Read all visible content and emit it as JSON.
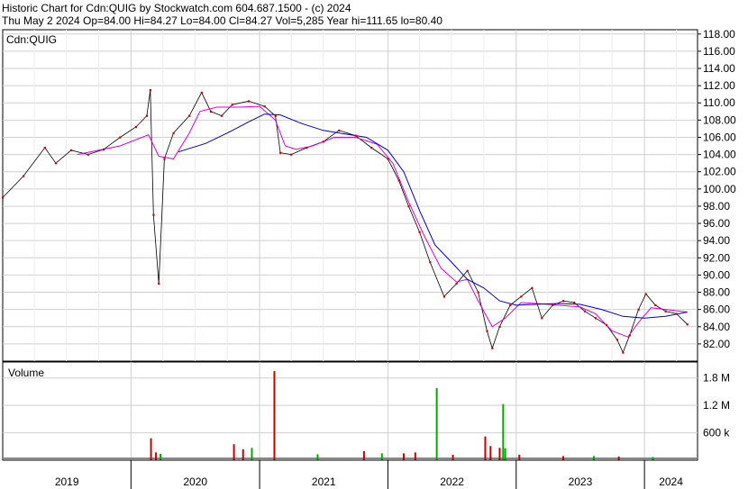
{
  "header": {
    "line1": "Historic Chart for Cdn:QUIG by Stockwatch.com 604.687.1500 - (c) 2024",
    "line2": "Thu May  2 2024  Op=84.00  Hi=84.27  Lo=84.00  Cl=84.27  Vol=5,285  Year hi=111.65  lo=80.40"
  },
  "chart_data": [
    {
      "type": "line",
      "panel_label": "Cdn:QUIG",
      "y_ticks": [
        82,
        84,
        86,
        88,
        90,
        92,
        94,
        96,
        98,
        100,
        102,
        104,
        106,
        108,
        110,
        112,
        114,
        116,
        118
      ],
      "ylim": [
        80.0,
        118.5
      ],
      "x_ticks": [
        "2019",
        "2020",
        "2021",
        "2022",
        "2023",
        "2024"
      ],
      "xlim": [
        "2019-01-01",
        "2024-05-31"
      ],
      "grid": true,
      "colors": {
        "price": "#cc0000",
        "price_alt": "#000000",
        "ma_short": "#dd00dd",
        "ma_long": "#0000cc"
      },
      "series": [
        {
          "values": [
            [
              "2019-01-01",
              99.0
            ],
            [
              "2019-03-01",
              101.5
            ],
            [
              "2019-05-01",
              104.8
            ],
            [
              "2019-06-01",
              103.0
            ],
            [
              "2019-07-15",
              104.5
            ],
            [
              "2019-09-01",
              104.0
            ],
            [
              "2019-10-15",
              104.6
            ],
            [
              "2019-12-01",
              106.0
            ],
            [
              "2020-01-15",
              107.2
            ],
            [
              "2020-02-15",
              108.5
            ],
            [
              "2020-02-25",
              111.5
            ],
            [
              "2020-03-05",
              97.0
            ],
            [
              "2020-03-20",
              89.0
            ],
            [
              "2020-04-05",
              103.5
            ],
            [
              "2020-05-01",
              106.5
            ],
            [
              "2020-06-15",
              108.5
            ],
            [
              "2020-07-20",
              111.2
            ],
            [
              "2020-08-15",
              109.0
            ],
            [
              "2020-09-15",
              108.5
            ],
            [
              "2020-10-15",
              109.8
            ],
            [
              "2020-12-01",
              110.2
            ],
            [
              "2021-01-15",
              109.6
            ],
            [
              "2021-02-15",
              108.5
            ],
            [
              "2021-03-01",
              104.2
            ],
            [
              "2021-04-01",
              104.0
            ],
            [
              "2021-05-15",
              104.8
            ],
            [
              "2021-07-01",
              105.5
            ],
            [
              "2021-08-15",
              106.8
            ],
            [
              "2021-10-01",
              106.2
            ],
            [
              "2021-11-15",
              104.8
            ],
            [
              "2022-01-01",
              103.5
            ],
            [
              "2022-02-01",
              101.0
            ],
            [
              "2022-03-01",
              98.0
            ],
            [
              "2022-04-01",
              95.0
            ],
            [
              "2022-05-01",
              91.5
            ],
            [
              "2022-06-10",
              87.5
            ],
            [
              "2022-07-15",
              89.0
            ],
            [
              "2022-08-15",
              90.5
            ],
            [
              "2022-09-15",
              88.0
            ],
            [
              "2022-10-10",
              83.5
            ],
            [
              "2022-10-25",
              81.5
            ],
            [
              "2022-11-15",
              84.0
            ],
            [
              "2022-12-15",
              86.5
            ],
            [
              "2023-01-15",
              87.5
            ],
            [
              "2023-02-15",
              88.5
            ],
            [
              "2023-03-15",
              85.0
            ],
            [
              "2023-04-15",
              86.5
            ],
            [
              "2023-05-15",
              87.0
            ],
            [
              "2023-06-15",
              86.8
            ],
            [
              "2023-07-15",
              85.8
            ],
            [
              "2023-08-15",
              85.0
            ],
            [
              "2023-09-15",
              84.2
            ],
            [
              "2023-10-15",
              82.5
            ],
            [
              "2023-11-01",
              81.0
            ],
            [
              "2023-11-20",
              83.0
            ],
            [
              "2023-12-15",
              86.0
            ],
            [
              "2024-01-05",
              87.8
            ],
            [
              "2024-02-01",
              86.5
            ],
            [
              "2024-03-01",
              85.8
            ],
            [
              "2024-04-01",
              85.5
            ],
            [
              "2024-05-02",
              84.27
            ]
          ]
        },
        {
          "values": [
            [
              "2019-08-01",
              104.0
            ],
            [
              "2019-12-01",
              105.0
            ],
            [
              "2020-02-20",
              106.3
            ],
            [
              "2020-03-20",
              103.8
            ],
            [
              "2020-05-01",
              103.5
            ],
            [
              "2020-06-15",
              106.5
            ],
            [
              "2020-07-15",
              109.0
            ],
            [
              "2020-09-01",
              109.5
            ],
            [
              "2020-11-01",
              109.5
            ],
            [
              "2021-01-01",
              109.6
            ],
            [
              "2021-02-15",
              108.0
            ],
            [
              "2021-03-15",
              105.0
            ],
            [
              "2021-04-15",
              104.6
            ],
            [
              "2021-06-01",
              105.0
            ],
            [
              "2021-08-01",
              106.0
            ],
            [
              "2021-10-01",
              106.0
            ],
            [
              "2021-12-01",
              105.2
            ],
            [
              "2022-01-15",
              103.0
            ],
            [
              "2022-03-01",
              98.5
            ],
            [
              "2022-04-15",
              94.5
            ],
            [
              "2022-06-01",
              90.8
            ],
            [
              "2022-07-15",
              89.2
            ],
            [
              "2022-08-15",
              89.5
            ],
            [
              "2022-09-15",
              87.0
            ],
            [
              "2022-10-25",
              84.0
            ],
            [
              "2022-12-01",
              85.0
            ],
            [
              "2023-01-15",
              86.8
            ],
            [
              "2023-03-01",
              86.7
            ],
            [
              "2023-05-01",
              86.5
            ],
            [
              "2023-07-01",
              86.3
            ],
            [
              "2023-08-15",
              85.5
            ],
            [
              "2023-10-01",
              83.5
            ],
            [
              "2023-11-15",
              82.8
            ],
            [
              "2023-12-15",
              84.5
            ],
            [
              "2024-01-20",
              86.2
            ],
            [
              "2024-03-01",
              86.0
            ],
            [
              "2024-05-02",
              85.7
            ]
          ]
        },
        {
          "values": [
            [
              "2020-05-15",
              104.3
            ],
            [
              "2020-08-01",
              105.3
            ],
            [
              "2020-10-01",
              106.5
            ],
            [
              "2020-12-01",
              107.8
            ],
            [
              "2021-01-15",
              108.7
            ],
            [
              "2021-03-01",
              108.6
            ],
            [
              "2021-05-01",
              107.6
            ],
            [
              "2021-07-01",
              106.8
            ],
            [
              "2021-09-01",
              106.4
            ],
            [
              "2021-11-01",
              106.0
            ],
            [
              "2022-01-01",
              104.5
            ],
            [
              "2022-02-15",
              102.0
            ],
            [
              "2022-04-01",
              97.5
            ],
            [
              "2022-05-15",
              93.5
            ],
            [
              "2022-07-01",
              91.5
            ],
            [
              "2022-08-15",
              89.5
            ],
            [
              "2022-10-01",
              88.5
            ],
            [
              "2022-11-15",
              87.0
            ],
            [
              "2023-01-01",
              86.5
            ],
            [
              "2023-03-01",
              86.6
            ],
            [
              "2023-05-01",
              86.7
            ],
            [
              "2023-07-01",
              86.6
            ],
            [
              "2023-09-01",
              86.0
            ],
            [
              "2023-11-01",
              85.2
            ],
            [
              "2024-01-01",
              85.0
            ],
            [
              "2024-03-01",
              85.2
            ],
            [
              "2024-05-02",
              85.7
            ]
          ]
        }
      ]
    },
    {
      "type": "bar",
      "panel_label": "Volume",
      "y_ticks": [
        "600 k",
        "1.2 M",
        "1.8 M"
      ],
      "y_tick_values": [
        600000,
        1200000,
        1800000
      ],
      "ylim": [
        0,
        2150000
      ],
      "colors": {
        "up": "#00aa00",
        "down": "#cc0000"
      },
      "series": [
        {
          "name": "down",
          "values": [
            [
              "2020-02-27",
              480000
            ],
            [
              "2020-03-12",
              170000
            ],
            [
              "2020-10-20",
              350000
            ],
            [
              "2020-11-15",
              240000
            ],
            [
              "2021-02-12",
              1950000
            ],
            [
              "2021-10-25",
              200000
            ],
            [
              "2022-02-15",
              150000
            ],
            [
              "2022-03-20",
              170000
            ],
            [
              "2022-07-05",
              120000
            ],
            [
              "2022-10-05",
              520000
            ],
            [
              "2022-10-20",
              310000
            ],
            [
              "2022-11-15",
              270000
            ],
            [
              "2023-01-10",
              120000
            ],
            [
              "2023-05-15",
              90000
            ],
            [
              "2023-10-20",
              80000
            ]
          ]
        },
        {
          "name": "up",
          "values": [
            [
              "2020-03-25",
              140000
            ],
            [
              "2020-12-10",
              270000
            ],
            [
              "2021-06-15",
              130000
            ],
            [
              "2021-12-15",
              150000
            ],
            [
              "2022-05-20",
              1580000
            ],
            [
              "2022-11-25",
              1230000
            ],
            [
              "2022-12-01",
              260000
            ],
            [
              "2023-08-10",
              90000
            ],
            [
              "2024-01-25",
              70000
            ]
          ]
        }
      ]
    }
  ]
}
